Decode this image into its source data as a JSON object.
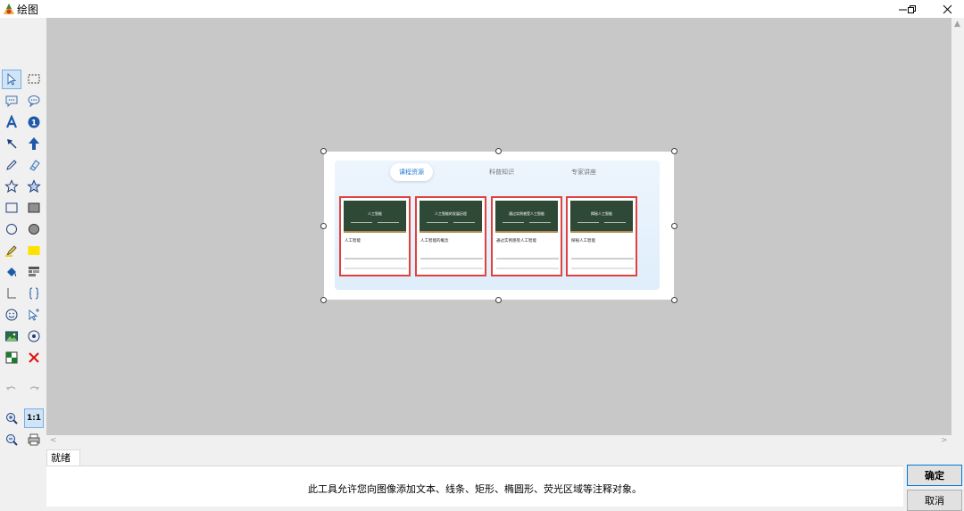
{
  "window": {
    "title": "绘图",
    "controls": [
      "minimize",
      "maximize",
      "close"
    ]
  },
  "toolbar": {
    "tools": [
      {
        "name": "select-arrow-icon",
        "active": true
      },
      {
        "name": "rectangle-select-icon"
      },
      {
        "name": "rect-callout-icon"
      },
      {
        "name": "round-callout-icon"
      },
      {
        "name": "text-icon"
      },
      {
        "name": "info-number-icon"
      },
      {
        "name": "arrow-thin-icon"
      },
      {
        "name": "arrow-bold-icon"
      },
      {
        "name": "pencil-icon"
      },
      {
        "name": "eraser-icon"
      },
      {
        "name": "star-outline-icon"
      },
      {
        "name": "star-filled-icon"
      },
      {
        "name": "rectangle-outline-icon"
      },
      {
        "name": "rectangle-filled-icon"
      },
      {
        "name": "ellipse-outline-icon"
      },
      {
        "name": "ellipse-filled-icon"
      },
      {
        "name": "highlighter-icon"
      },
      {
        "name": "highlight-rect-icon"
      },
      {
        "name": "fill-bucket-icon"
      },
      {
        "name": "mosaic-icon"
      },
      {
        "name": "line-angle-icon"
      },
      {
        "name": "braces-icon"
      },
      {
        "name": "emoji-icon"
      },
      {
        "name": "cursor-plus-icon"
      },
      {
        "name": "image-icon"
      },
      {
        "name": "magnifier-spot-icon"
      },
      {
        "name": "color-picker-icon"
      },
      {
        "name": "delete-icon"
      }
    ],
    "undo": "undo-icon",
    "redo": "redo-icon",
    "zoom_in": "zoom-in-icon",
    "zoom_one_to_one": "1:1",
    "zoom_out": "zoom-out-icon",
    "print": "print-icon"
  },
  "canvas_image": {
    "tabs": [
      "课程资源",
      "科普知识",
      "专家讲座"
    ],
    "cards": [
      {
        "board_title": "人工智能",
        "title": "人工智能"
      },
      {
        "board_title": "人工智能的发展历程",
        "title": "人工智能的概念"
      },
      {
        "board_title": "通过实例感受人工智能",
        "title": "通过实例感受人工智能"
      },
      {
        "board_title": "揭秘人工智能",
        "title": "探秘人工智能"
      }
    ]
  },
  "status": {
    "tab_label": "就绪",
    "message": "此工具允许您向图像添加文本、线条、矩形、椭圆形、荧光区域等注释对象。"
  },
  "buttons": {
    "ok": "确定",
    "cancel": "取消"
  },
  "colors": {
    "accent": "#2a7ad6",
    "card_border": "#e0423e",
    "canvas_bg": "#c8c8c8",
    "board": "#2e4a36"
  }
}
